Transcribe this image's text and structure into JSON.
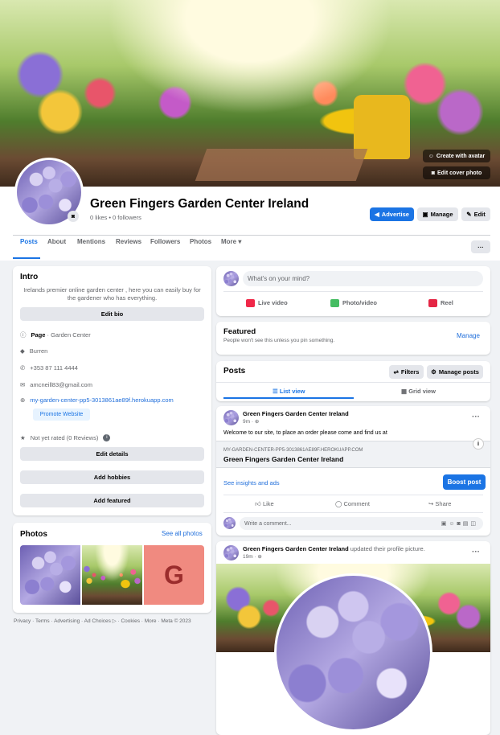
{
  "cover": {
    "create_avatar_label": "Create with avatar",
    "edit_cover_label": "Edit cover photo"
  },
  "profile": {
    "name": "Green Fingers Garden Center Ireland",
    "stats": "0 likes • 0 followers"
  },
  "actions": {
    "advertise": "Advertise",
    "manage": "Manage",
    "edit": "Edit",
    "more_dots": "···"
  },
  "tabs": [
    "Posts",
    "About",
    "Mentions",
    "Reviews",
    "Followers",
    "Photos",
    "More"
  ],
  "intro": {
    "title": "Intro",
    "bio": "Irelands premier online garden center , here you can easily buy for the gardener who has everything.",
    "edit_bio": "Edit bio",
    "page_label": "Page",
    "page_category": " · Garden Center",
    "location": "Burren",
    "phone": "+353 87 111 4444",
    "email": "amcneill83@gmail.com",
    "website": "my-garden-center-pp5-3013861ae89f.herokuapp.com",
    "promote_website": "Promote Website",
    "rating": "Not yet rated (0 Reviews)",
    "edit_details": "Edit details",
    "add_hobbies": "Add hobbies",
    "add_featured": "Add featured"
  },
  "photos": {
    "title": "Photos",
    "see_all": "See all photos",
    "letter_tile": "G"
  },
  "footer": "Privacy · Terms · Advertising · Ad Choices ▷ · Cookies · More · Meta © 2023",
  "composer": {
    "placeholder": "What's on your mind?",
    "live_video": "Live video",
    "photo_video": "Photo/video",
    "reel": "Reel"
  },
  "featured": {
    "title": "Featured",
    "subtitle": "People won't see this unless you pin something.",
    "manage": "Manage"
  },
  "posts_header": {
    "title": "Posts",
    "filters": "Filters",
    "manage_posts": "Manage posts",
    "list_view": "List view",
    "grid_view": "Grid view"
  },
  "post1": {
    "author": "Green Fingers Garden Center Ireland",
    "time": "9m · ",
    "text": "Welcome to our site, to place an order please come and find us at",
    "link_domain": "MY-GARDEN-CENTER-PP5-3013861AE89F.HEROKUAPP.COM",
    "link_title": "Green Fingers Garden Center Ireland",
    "insights": "See insights and ads",
    "boost": "Boost post",
    "like": "Like",
    "comment": "Comment",
    "share": "Share",
    "comment_placeholder": "Write a comment..."
  },
  "post2": {
    "author": "Green Fingers Garden Center Ireland",
    "action": " updated their profile picture.",
    "time": "19m · "
  },
  "colors": {
    "accent": "#1b74e4",
    "link": "#216fdb",
    "background": "#f0f2f5"
  }
}
